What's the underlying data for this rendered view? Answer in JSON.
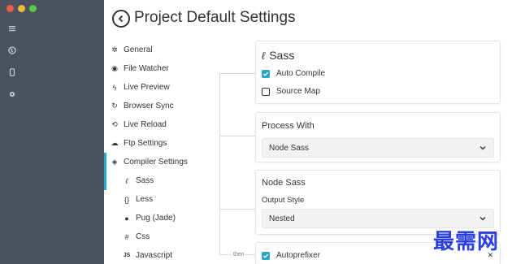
{
  "window": {
    "dots": [
      "#ee5b4f",
      "#f0b83a",
      "#5cc542"
    ],
    "rail_icons": [
      "menu-icon",
      "globe-icon",
      "mobile-icon",
      "gear-icon"
    ]
  },
  "header": {
    "title": "Project Default Settings"
  },
  "nav": {
    "items": [
      {
        "label": "General",
        "icon": "gear-icon"
      },
      {
        "label": "File Watcher",
        "icon": "eye-icon"
      },
      {
        "label": "Live Preview",
        "icon": "bolt-icon"
      },
      {
        "label": "Browser Sync",
        "icon": "sync-icon"
      },
      {
        "label": "Live Reload",
        "icon": "reload-icon"
      },
      {
        "label": "Ftp Settings",
        "icon": "cloud-icon"
      },
      {
        "label": "Compiler Settings",
        "icon": "layers-icon"
      }
    ],
    "sub_items": [
      {
        "label": "Sass",
        "icon": "sass-icon"
      },
      {
        "label": "Less",
        "icon": "braces-icon"
      },
      {
        "label": "Pug (Jade)",
        "icon": "pug-icon"
      },
      {
        "label": "Css",
        "icon": "hash-icon"
      },
      {
        "label": "Javascript",
        "icon": "js-icon"
      }
    ]
  },
  "sass_card": {
    "title": "Sass",
    "auto_compile": {
      "label": "Auto Compile",
      "checked": true
    },
    "source_map": {
      "label": "Source Map",
      "checked": false
    }
  },
  "process_card": {
    "title": "Process With",
    "value": "Node Sass"
  },
  "node_sass_card": {
    "title": "Node Sass",
    "output_style_label": "Output Style",
    "output_style_value": "Nested"
  },
  "autoprefixer_card": {
    "label": "Autoprefixer",
    "checked": true,
    "connector_label": "then"
  },
  "watermark": "最需网",
  "colors": {
    "accent": "#2aa6c9",
    "rail": "#4a5260"
  }
}
